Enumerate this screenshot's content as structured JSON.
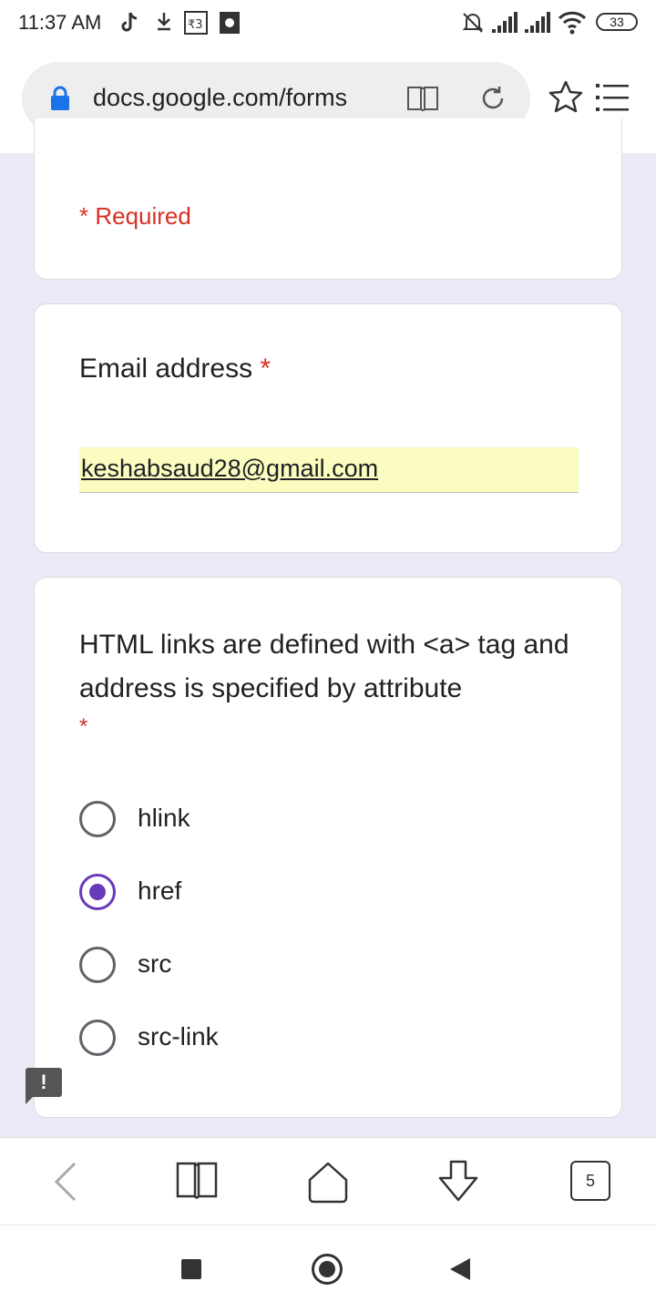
{
  "status_bar": {
    "time": "11:37 AM",
    "battery": "33",
    "icons": [
      "tiktok-icon",
      "download-icon",
      "app-icon",
      "app-icon-2",
      "silent-bell-icon",
      "signal-icon",
      "signal-icon-2",
      "wifi-icon"
    ]
  },
  "browser": {
    "url": "docs.google.com/forms",
    "tab_count": "5"
  },
  "form": {
    "required_note": "* Required",
    "email_question": {
      "label": "Email address",
      "required_mark": "*",
      "value": "keshabsaud28@gmail.com"
    },
    "question": {
      "text": "HTML links are defined with <a> tag and address is specified by attribute",
      "required_mark": "*",
      "options": [
        {
          "label": "hlink",
          "selected": false
        },
        {
          "label": "href",
          "selected": true
        },
        {
          "label": "src",
          "selected": false
        },
        {
          "label": "src-link",
          "selected": false
        }
      ]
    },
    "feedback_label": "!"
  },
  "colors": {
    "accent": "#673ab7",
    "required": "#d93025",
    "background": "#ede9f6",
    "autofill": "#fafcc0",
    "lock": "#1a73e8"
  }
}
